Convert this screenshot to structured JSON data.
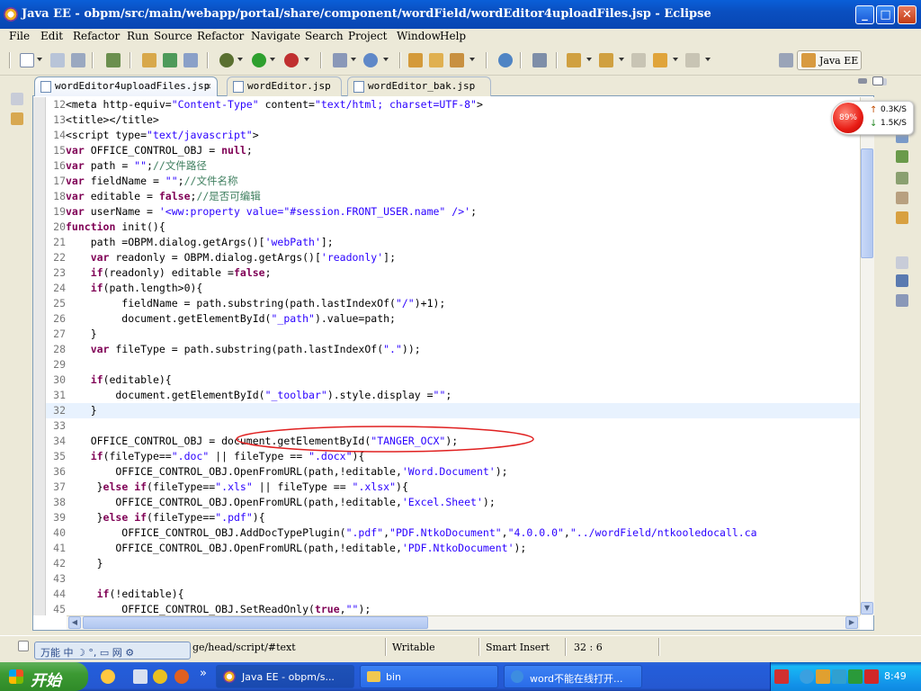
{
  "window": {
    "title": "Java EE - obpm/src/main/webapp/portal/share/component/wordField/wordEditor4uploadFiles.jsp - Eclipse",
    "minimize": "_",
    "maximize": "□",
    "close": "✕"
  },
  "menu": [
    "File",
    "Edit",
    "Refactor",
    "Run",
    "Source",
    "Refactor",
    "Navigate",
    "Search",
    "Project",
    "Window",
    "Help"
  ],
  "perspective": {
    "label": "Java EE"
  },
  "tabs": [
    {
      "label": "wordEditor4uploadFiles.jsp",
      "close": "✕",
      "active": true
    },
    {
      "label": "wordEditor.jsp",
      "active": false
    },
    {
      "label": "wordEditor_bak.jsp",
      "active": false
    }
  ],
  "code_lines": [
    {
      "n": "12",
      "text": "<meta http-equiv=\"Content-Type\" content=\"text/html; charset=UTF-8\">"
    },
    {
      "n": "13",
      "text": "<title></title>"
    },
    {
      "n": "14",
      "text": "<script type=\"text/javascript\">"
    },
    {
      "n": "15",
      "text": "var OFFICE_CONTROL_OBJ = null;"
    },
    {
      "n": "16",
      "text": "var path = \"\";//文件路径"
    },
    {
      "n": "17",
      "text": "var fieldName = \"\";//文件名称"
    },
    {
      "n": "18",
      "text": "var editable = false;//是否可编辑"
    },
    {
      "n": "19",
      "text": "var userName = '<ww:property value=\"#session.FRONT_USER.name\" />';"
    },
    {
      "n": "20",
      "text": "function init(){"
    },
    {
      "n": "21",
      "text": "    path =OBPM.dialog.getArgs()['webPath'];"
    },
    {
      "n": "22",
      "text": "    var readonly = OBPM.dialog.getArgs()['readonly'];"
    },
    {
      "n": "23",
      "text": "    if(readonly) editable =false;"
    },
    {
      "n": "24",
      "text": "    if(path.length>0){"
    },
    {
      "n": "25",
      "text": "         fieldName = path.substring(path.lastIndexOf(\"/\")+1);"
    },
    {
      "n": "26",
      "text": "         document.getElementById(\"_path\").value=path;"
    },
    {
      "n": "27",
      "text": "    }"
    },
    {
      "n": "28",
      "text": "    var fileType = path.substring(path.lastIndexOf(\".\"));"
    },
    {
      "n": "29",
      "text": ""
    },
    {
      "n": "30",
      "text": "    if(editable){"
    },
    {
      "n": "31",
      "text": "        document.getElementById(\"_toolbar\").style.display =\"\";"
    },
    {
      "n": "32",
      "text": "    }"
    },
    {
      "n": "33",
      "text": ""
    },
    {
      "n": "34",
      "text": "    OFFICE_CONTROL_OBJ = document.getElementById(\"TANGER_OCX\");"
    },
    {
      "n": "35",
      "text": "    if(fileType==\".doc\" || fileType == \".docx\"){"
    },
    {
      "n": "36",
      "text": "        OFFICE_CONTROL_OBJ.OpenFromURL(path,!editable,'Word.Document');"
    },
    {
      "n": "37",
      "text": "     }else if(fileType==\".xls\" || fileType == \".xlsx\"){"
    },
    {
      "n": "38",
      "text": "        OFFICE_CONTROL_OBJ.OpenFromURL(path,!editable,'Excel.Sheet');"
    },
    {
      "n": "39",
      "text": "     }else if(fileType==\".pdf\"){"
    },
    {
      "n": "40",
      "text": "         OFFICE_CONTROL_OBJ.AddDocTypePlugin(\".pdf\",\"PDF.NtkoDocument\",\"4.0.0.0\",\"../wordField/ntkooledocall.ca"
    },
    {
      "n": "41",
      "text": "        OFFICE_CONTROL_OBJ.OpenFromURL(path,!editable,'PDF.NtkoDocument');"
    },
    {
      "n": "42",
      "text": "     }"
    },
    {
      "n": "43",
      "text": ""
    },
    {
      "n": "44",
      "text": "     if(!editable){"
    },
    {
      "n": "45",
      "text": "         OFFICE_CONTROL_OBJ.SetReadOnly(true,\"\");"
    }
  ],
  "status": {
    "path": "ge/head/script/#text",
    "writable": "Writable",
    "insert_mode": "Smart Insert",
    "position": "32 : 6"
  },
  "ime": "万能  中 ☽ °, ▭ 网 ⚙",
  "netmeter": {
    "percent": "89%",
    "up": "0.3K/S",
    "down": "1.5K/S",
    "up_arrow": "↑",
    "down_arrow": "↓"
  },
  "taskbar": {
    "start": "开始",
    "chevron": "»",
    "tasks": [
      "Java EE - obpm/s...",
      "bin",
      "word不能在线打开..."
    ],
    "clock": "8:49"
  },
  "colors": {
    "title_bar": "#0a5fd8",
    "taskbar": "#245edb",
    "start": "#3c9a33",
    "keyword": "#7f0055",
    "string": "#2a00ff",
    "comment": "#3f7f5f",
    "annotation": "#e02020"
  }
}
